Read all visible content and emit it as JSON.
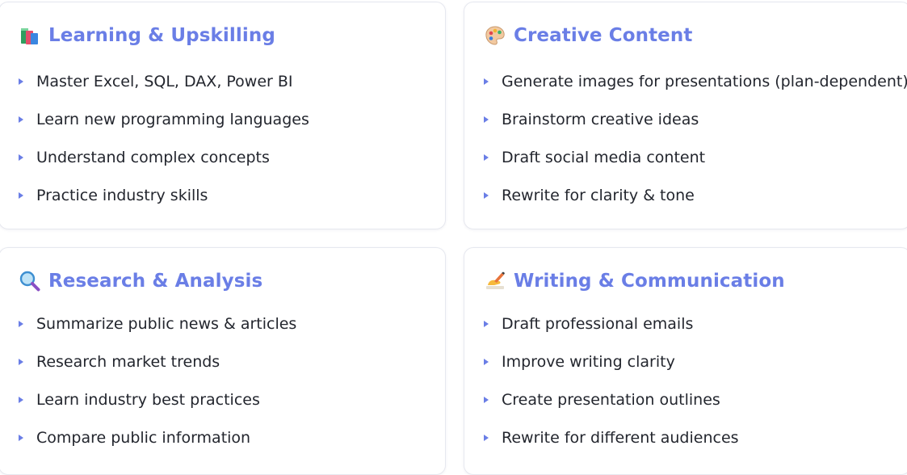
{
  "cards": [
    {
      "title": "Learning & Upskilling",
      "icon": "books-icon",
      "items": [
        "Master Excel, SQL, DAX, Power BI",
        "Learn new programming languages",
        "Understand complex concepts",
        "Practice industry skills"
      ]
    },
    {
      "title": "Creative Content",
      "icon": "palette-icon",
      "items": [
        "Generate images for presentations (plan-dependent)",
        "Brainstorm creative ideas",
        "Draft social media content",
        "Rewrite for clarity & tone"
      ]
    },
    {
      "title": "Research & Analysis",
      "icon": "magnifier-icon",
      "items": [
        "Summarize public news & articles",
        "Research market trends",
        "Learn industry best practices",
        "Compare public information"
      ]
    },
    {
      "title": "Writing & Communication",
      "icon": "writing-hand-icon",
      "items": [
        "Draft professional emails",
        "Improve writing clarity",
        "Create presentation outlines",
        "Rewrite for different audiences"
      ]
    }
  ],
  "colors": {
    "accent": "#6a7ee6",
    "text": "#23262e",
    "border": "#e6e8ef"
  }
}
